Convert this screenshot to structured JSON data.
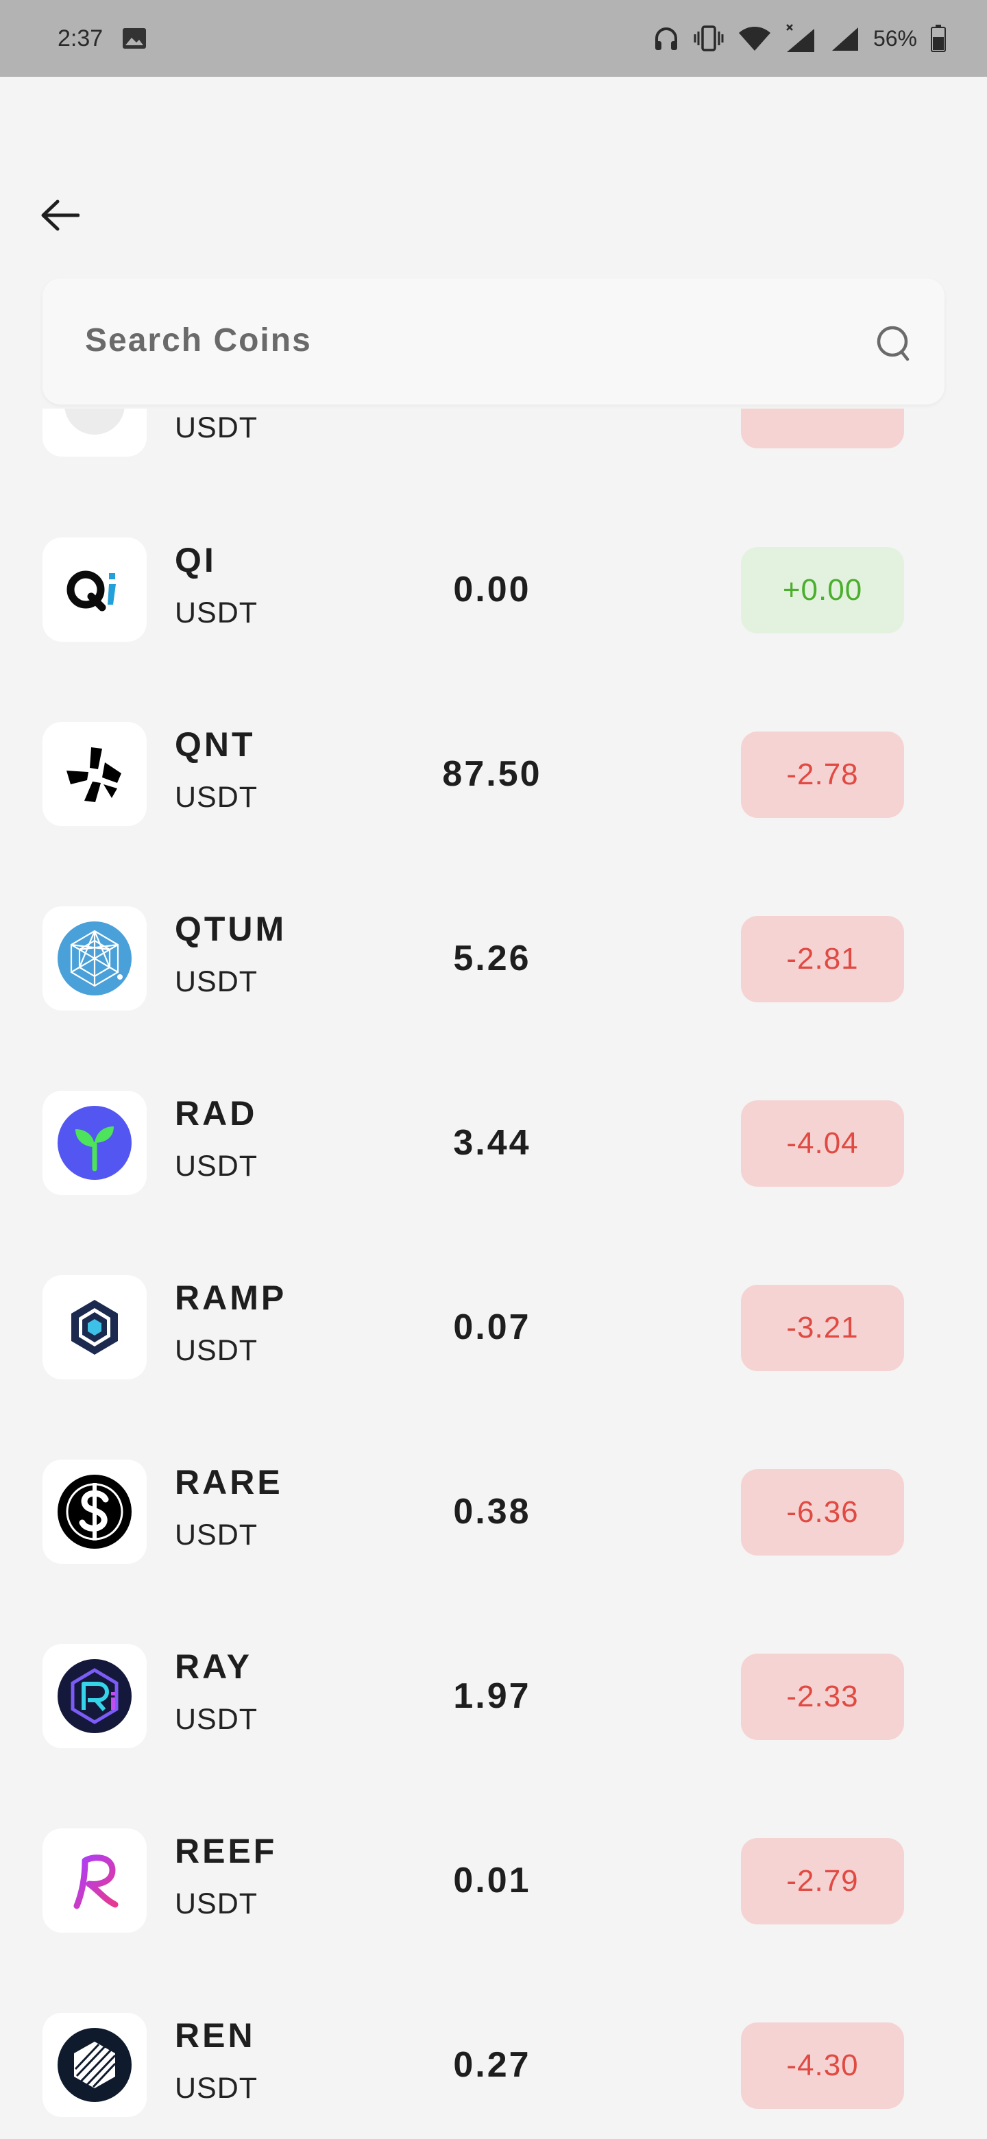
{
  "status_bar": {
    "time": "2:37",
    "battery": "56%",
    "icons": [
      "image-icon",
      "headphones-icon",
      "vibrate-icon",
      "wifi-icon",
      "signal-x-icon",
      "signal-icon",
      "battery-icon"
    ]
  },
  "search": {
    "placeholder": "Search Coins"
  },
  "colors": {
    "negative": "#e04a43",
    "negative_bg": "#f5d3d2",
    "positive": "#4cae2f",
    "positive_bg": "#e3f2de"
  },
  "coins": [
    {
      "symbol": "",
      "quote": "USDT",
      "price": "",
      "change": "",
      "direction": "down",
      "icon": "partial-coin-icon"
    },
    {
      "symbol": "QI",
      "quote": "USDT",
      "price": "0.00",
      "change": "+0.00",
      "direction": "up",
      "icon": "qi-logo-icon"
    },
    {
      "symbol": "QNT",
      "quote": "USDT",
      "price": "87.50",
      "change": "-2.78",
      "direction": "down",
      "icon": "qnt-logo-icon"
    },
    {
      "symbol": "QTUM",
      "quote": "USDT",
      "price": "5.26",
      "change": "-2.81",
      "direction": "down",
      "icon": "qtum-logo-icon"
    },
    {
      "symbol": "RAD",
      "quote": "USDT",
      "price": "3.44",
      "change": "-4.04",
      "direction": "down",
      "icon": "rad-logo-icon"
    },
    {
      "symbol": "RAMP",
      "quote": "USDT",
      "price": "0.07",
      "change": "-3.21",
      "direction": "down",
      "icon": "ramp-logo-icon"
    },
    {
      "symbol": "RARE",
      "quote": "USDT",
      "price": "0.38",
      "change": "-6.36",
      "direction": "down",
      "icon": "rare-logo-icon"
    },
    {
      "symbol": "RAY",
      "quote": "USDT",
      "price": "1.97",
      "change": "-2.33",
      "direction": "down",
      "icon": "ray-logo-icon"
    },
    {
      "symbol": "REEF",
      "quote": "USDT",
      "price": "0.01",
      "change": "-2.79",
      "direction": "down",
      "icon": "reef-logo-icon"
    },
    {
      "symbol": "REN",
      "quote": "USDT",
      "price": "0.27",
      "change": "-4.30",
      "direction": "down",
      "icon": "ren-logo-icon"
    }
  ]
}
